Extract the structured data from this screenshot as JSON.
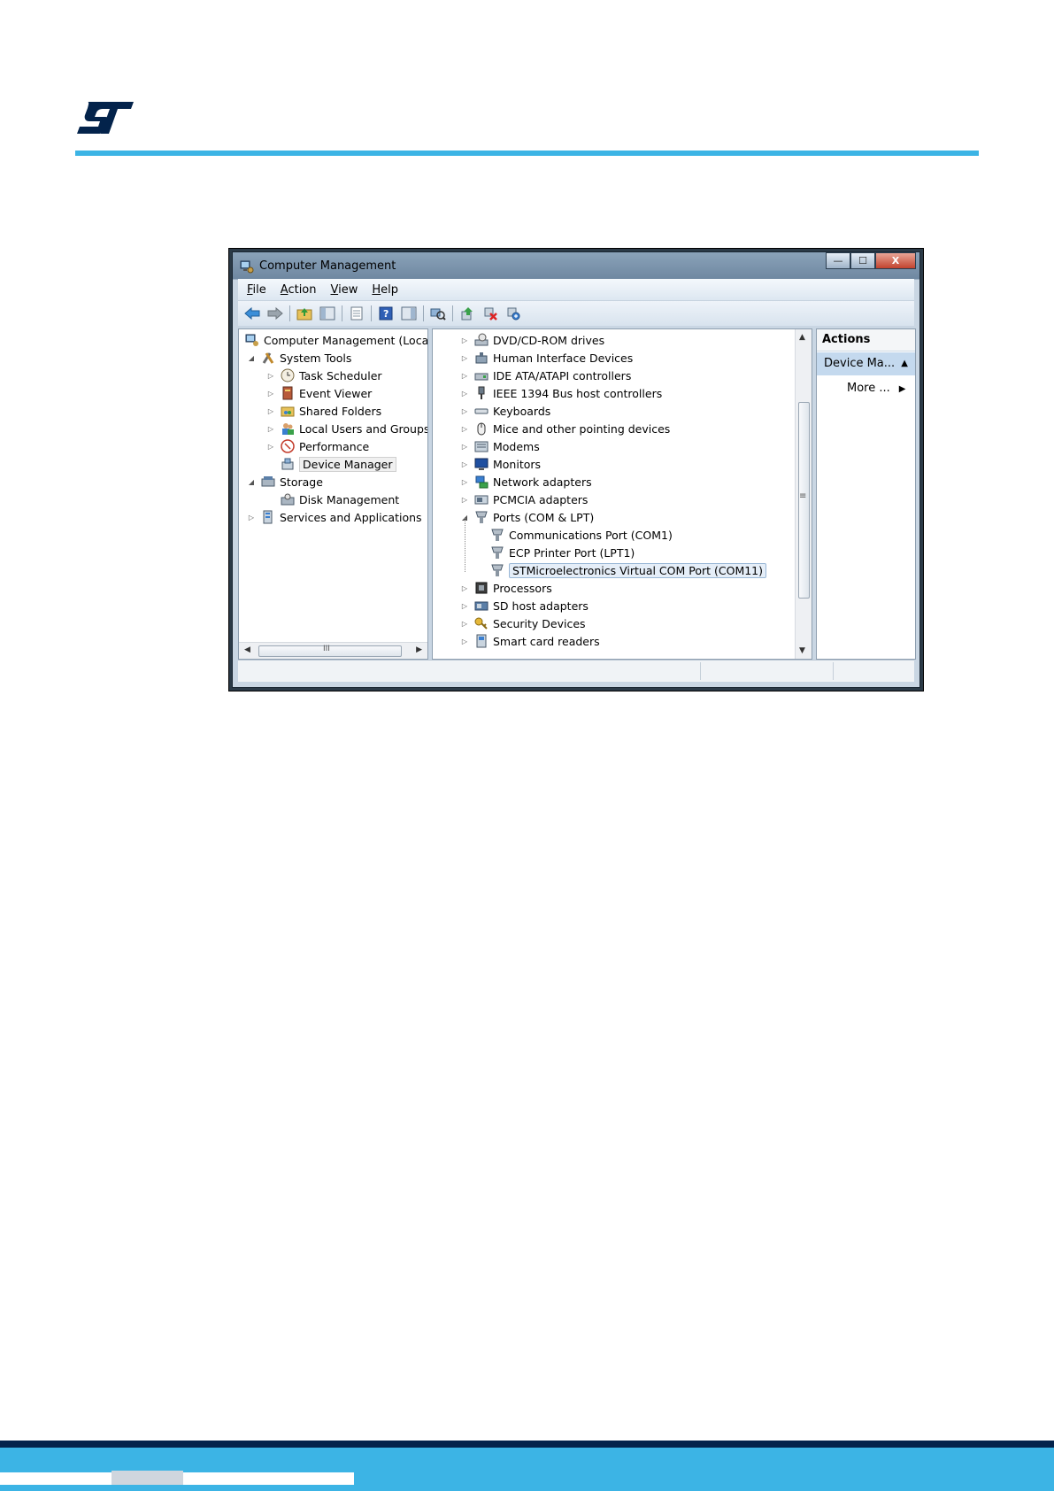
{
  "window": {
    "title": "Computer Management",
    "caption_buttons": {
      "minimize": "—",
      "maximize": "☐",
      "close": "X"
    }
  },
  "menu": [
    {
      "key": "F",
      "rest": "ile"
    },
    {
      "key": "A",
      "rest": "ction"
    },
    {
      "key": "V",
      "rest": "iew"
    },
    {
      "key": "H",
      "rest": "elp"
    }
  ],
  "left_tree": {
    "root": "Computer Management (Local",
    "system_tools": "System Tools",
    "task_scheduler": "Task Scheduler",
    "event_viewer": "Event Viewer",
    "shared_folders": "Shared Folders",
    "local_users": "Local Users and Groups",
    "performance": "Performance",
    "device_manager": "Device Manager",
    "storage": "Storage",
    "disk_management": "Disk Management",
    "services": "Services and Applications",
    "hscroll_grip": "III"
  },
  "device_tree": {
    "dvd": "DVD/CD-ROM drives",
    "hid": "Human Interface Devices",
    "ide": "IDE ATA/ATAPI controllers",
    "ieee": "IEEE 1394 Bus host controllers",
    "keyboards": "Keyboards",
    "mice": "Mice and other pointing devices",
    "modems": "Modems",
    "monitors": "Monitors",
    "network": "Network adapters",
    "pcmcia": "PCMCIA adapters",
    "ports": "Ports (COM & LPT)",
    "com1": "Communications Port (COM1)",
    "lpt1": "ECP Printer Port (LPT1)",
    "com11": "STMicroelectronics Virtual COM Port (COM11)",
    "processors": "Processors",
    "sd": "SD host adapters",
    "security": "Security Devices",
    "smartcard": "Smart card readers",
    "vscroll_grip": "≡"
  },
  "actions": {
    "header": "Actions",
    "item": "Device Ma...",
    "more": "More ..."
  }
}
